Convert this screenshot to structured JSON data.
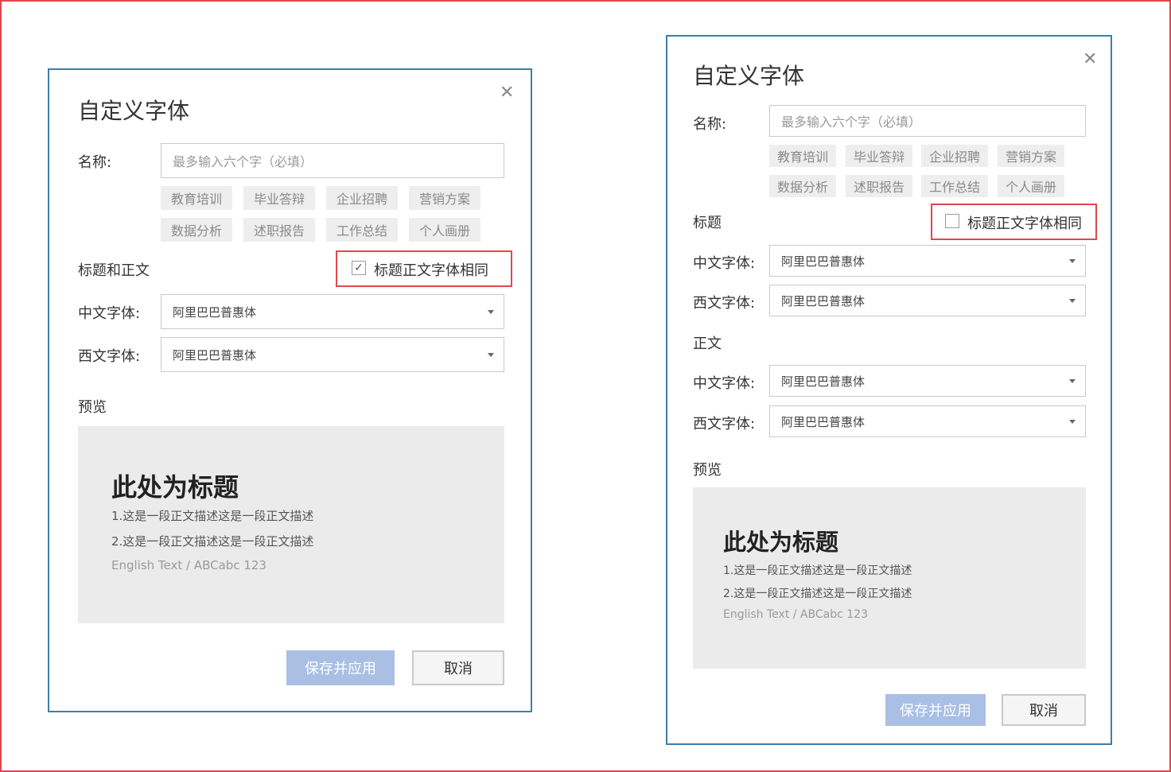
{
  "left_dialog": {
    "title": "自定义字体",
    "name_label": "名称:",
    "name_placeholder": "最多输入六个字（必填）",
    "tags": [
      "教育培训",
      "毕业答辩",
      "企业招聘",
      "营销方案",
      "数据分析",
      "述职报告",
      "工作总结",
      "个人画册"
    ],
    "section_label": "标题和正文",
    "same_font_label": "标题正文字体相同",
    "same_font_checked": true,
    "chinese_font_label": "中文字体:",
    "chinese_font_value": "阿里巴巴普惠体",
    "western_font_label": "西文字体:",
    "western_font_value": "阿里巴巴普惠体",
    "preview_label": "预览",
    "preview": {
      "heading": "此处为标题",
      "line1": "1.这是一段正文描述这是一段正文描述",
      "line2": "2.这是一段正文描述这是一段正文描述",
      "english": "English Text / ABCabc 123"
    },
    "save_button": "保存并应用",
    "cancel_button": "取消"
  },
  "right_dialog": {
    "title": "自定义字体",
    "name_label": "名称:",
    "name_placeholder": "最多输入六个字（必填）",
    "tags": [
      "教育培训",
      "毕业答辩",
      "企业招聘",
      "营销方案",
      "数据分析",
      "述职报告",
      "工作总结",
      "个人画册"
    ],
    "heading_section_label": "标题",
    "same_font_label": "标题正文字体相同",
    "same_font_checked": false,
    "heading_chinese_font_label": "中文字体:",
    "heading_chinese_font_value": "阿里巴巴普惠体",
    "heading_western_font_label": "西文字体:",
    "heading_western_font_value": "阿里巴巴普惠体",
    "body_section_label": "正文",
    "body_chinese_font_label": "中文字体:",
    "body_chinese_font_value": "阿里巴巴普惠体",
    "body_western_font_label": "西文字体:",
    "body_western_font_value": "阿里巴巴普惠体",
    "preview_label": "预览",
    "preview": {
      "heading": "此处为标题",
      "line1": "1.这是一段正文描述这是一段正文描述",
      "line2": "2.这是一段正文描述这是一段正文描述",
      "english": "English Text / ABCabc 123"
    },
    "save_button": "保存并应用",
    "cancel_button": "取消"
  },
  "colors": {
    "dialog_border": "#3d7ea6",
    "highlight_red": "#e0474c",
    "primary_button": "#a9bfe4",
    "tag_background": "#eeeeee",
    "preview_background": "#ebebeb"
  }
}
